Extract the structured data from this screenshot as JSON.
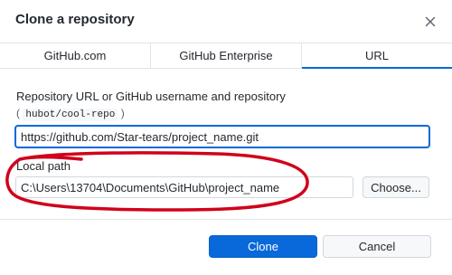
{
  "dialog": {
    "title": "Clone a repository",
    "close_icon": "close-icon"
  },
  "tabs": [
    {
      "label": "GitHub.com",
      "selected": false
    },
    {
      "label": "GitHub Enterprise",
      "selected": false
    },
    {
      "label": "URL",
      "selected": true
    }
  ],
  "url_section": {
    "label": "Repository URL or GitHub username and repository",
    "hint_open": "(",
    "hint_code": "hubot/cool-repo",
    "hint_close": ")",
    "value": "https://github.com/Star-tears/project_name.git"
  },
  "local_path": {
    "label": "Local path",
    "value": "C:\\Users\\13704\\Documents\\GitHub\\project_name",
    "choose_label": "Choose..."
  },
  "footer": {
    "clone_label": "Clone",
    "cancel_label": "Cancel"
  },
  "colors": {
    "accent": "#0969da",
    "annotation": "#d0021b"
  }
}
